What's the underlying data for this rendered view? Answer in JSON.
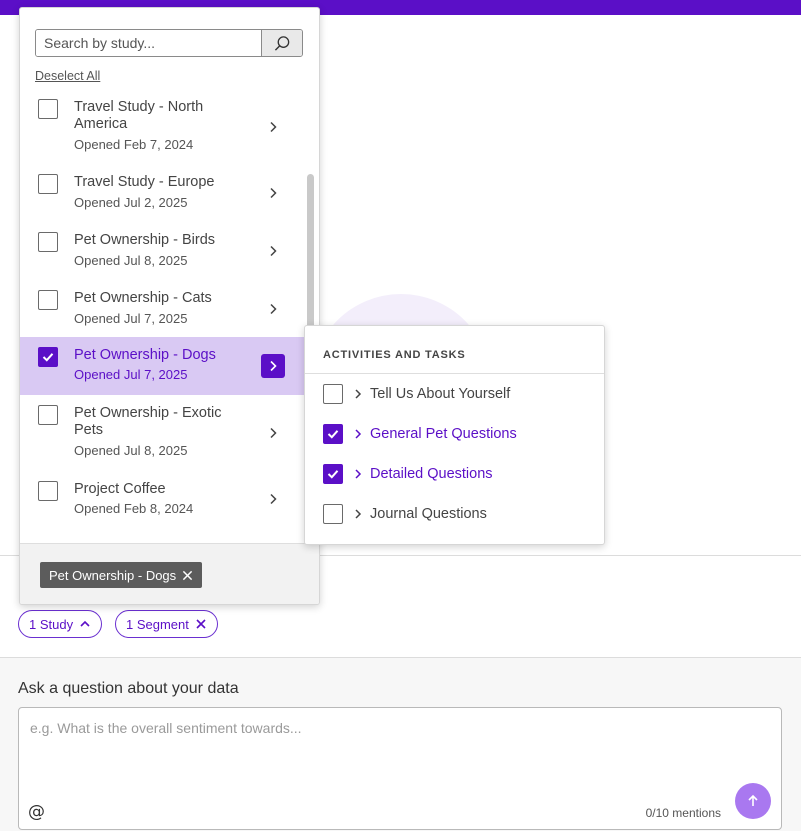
{
  "search": {
    "placeholder": "Search by study..."
  },
  "deselect_label": "Deselect All",
  "studies": [
    {
      "title": "Travel Study - North America",
      "opened": "Opened Feb 7, 2024",
      "checked": false
    },
    {
      "title": "Travel Study - Europe",
      "opened": "Opened Jul 2, 2025",
      "checked": false
    },
    {
      "title": "Pet Ownership - Birds",
      "opened": "Opened Jul 8, 2025",
      "checked": false
    },
    {
      "title": "Pet Ownership - Cats",
      "opened": "Opened Jul 7, 2025",
      "checked": false
    },
    {
      "title": "Pet Ownership - Dogs",
      "opened": "Opened Jul 7, 2025",
      "checked": true
    },
    {
      "title": "Pet Ownership - Exotic Pets",
      "opened": "Opened Jul 8, 2025",
      "checked": false
    },
    {
      "title": "Project Coffee",
      "opened": "Opened Feb 8, 2024",
      "checked": false
    }
  ],
  "selected_tag": "Pet Ownership - Dogs",
  "activities": {
    "header": "ACTIVITIES AND TASKS",
    "items": [
      {
        "label": "Tell Us About Yourself",
        "checked": false
      },
      {
        "label": "General Pet Questions",
        "checked": true
      },
      {
        "label": "Detailed Questions",
        "checked": true
      },
      {
        "label": "Journal Questions",
        "checked": false
      }
    ]
  },
  "filters": {
    "study_chip": "1 Study",
    "segment_chip": "1 Segment"
  },
  "ask": {
    "label": "Ask a question about your data",
    "placeholder": "e.g. What is the overall sentiment towards...",
    "mentions": "0/10 mentions",
    "at_symbol": "@"
  },
  "colors": {
    "accent": "#5b0fc7",
    "selected_bg": "#d9c9f3",
    "send_button": "#a978f0"
  }
}
